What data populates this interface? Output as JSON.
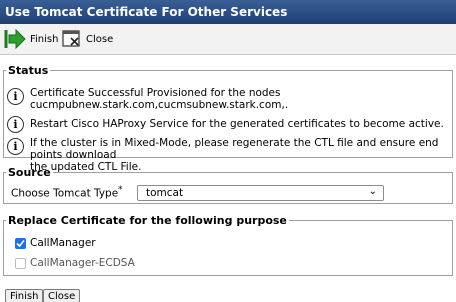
{
  "window": {
    "title": "Use Tomcat Certificate For Other Services"
  },
  "toolbar": {
    "finish_label": "Finish",
    "close_label": "Close"
  },
  "status": {
    "legend": "Status",
    "messages": [
      {
        "line1": "Certificate Successful Provisioned for the nodes",
        "line2": "cucmpubnew.stark.com,cucmsubnew.stark.com,."
      },
      {
        "line1": "Restart Cisco HAProxy Service for the generated certificates to become active."
      },
      {
        "line1": "If the cluster is in Mixed-Mode, please regenerate the CTL file and ensure end points download",
        "line2": "the updated CTL File."
      }
    ]
  },
  "source": {
    "legend": "Source",
    "type_label": "Choose Tomcat Type",
    "required_mark": "*",
    "selected": "tomcat"
  },
  "purpose": {
    "legend": "Replace Certificate for the following purpose",
    "options": [
      {
        "label": "CallManager",
        "checked": true
      },
      {
        "label": "CallManager-ECDSA",
        "checked": false
      }
    ]
  },
  "footer": {
    "finish_label": "Finish",
    "close_label": "Close"
  },
  "colors": {
    "titlebar": "#2b4a7d",
    "checkbox": "#1a73e8"
  }
}
